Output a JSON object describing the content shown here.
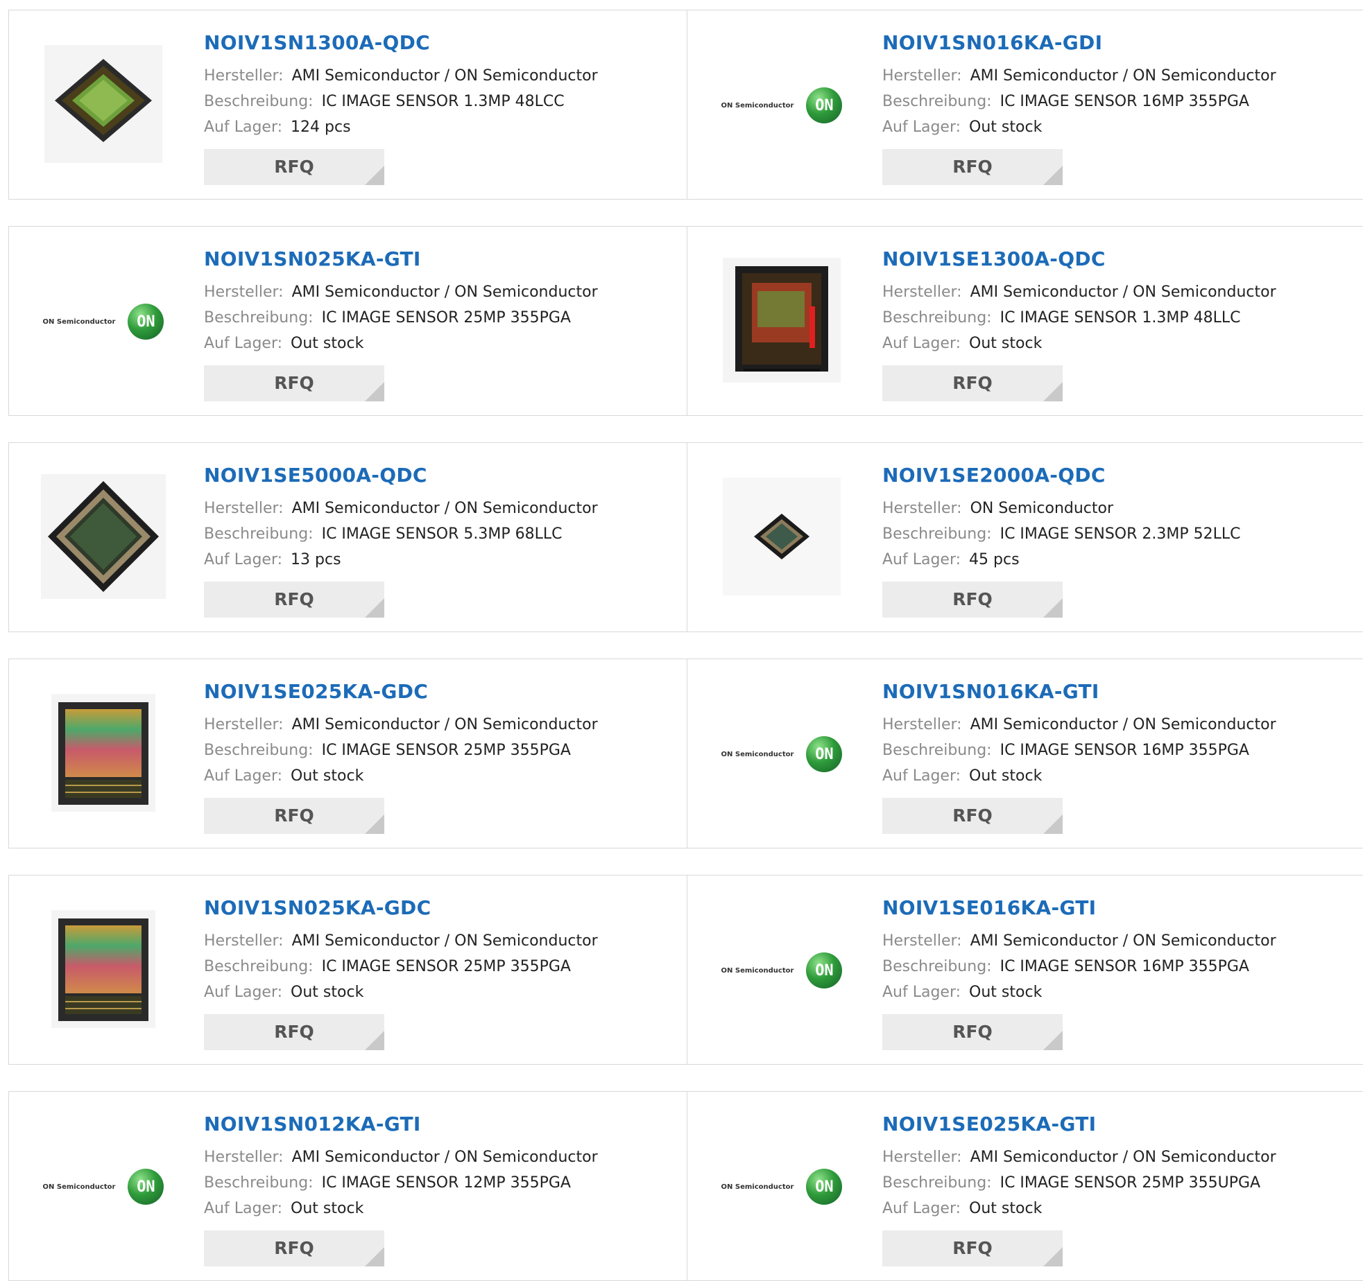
{
  "labels": {
    "manufacturer": "Hersteller:",
    "description": "Beschreibung:",
    "stock": "Auf Lager:",
    "rfq": "RFQ"
  },
  "logo": {
    "text": "ON Semiconductor",
    "mark": "ON"
  },
  "products": [
    {
      "part": "NOIV1SN1300A-QDC",
      "manufacturer": "AMI Semiconductor / ON Semiconductor",
      "description": "IC IMAGE SENSOR 1.3MP 48LCC",
      "stock": "124 pcs",
      "image": "chip-diamond-green-icon"
    },
    {
      "part": "NOIV1SN016KA-GDI",
      "manufacturer": "AMI Semiconductor / ON Semiconductor",
      "description": "IC IMAGE SENSOR 16MP 355PGA",
      "stock": "Out stock",
      "image": "on-semiconductor-logo"
    },
    {
      "part": "NOIV1SN025KA-GTI",
      "manufacturer": "AMI Semiconductor / ON Semiconductor",
      "description": "IC IMAGE SENSOR 25MP 355PGA",
      "stock": "Out stock",
      "image": "on-semiconductor-logo"
    },
    {
      "part": "NOIV1SE1300A-QDC",
      "manufacturer": "AMI Semiconductor / ON Semiconductor",
      "description": "IC IMAGE SENSOR 1.3MP 48LLC",
      "stock": "Out stock",
      "image": "chip-square-red-icon"
    },
    {
      "part": "NOIV1SE5000A-QDC",
      "manufacturer": "AMI Semiconductor / ON Semiconductor",
      "description": "IC IMAGE SENSOR 5.3MP 68LLC",
      "stock": "13 pcs",
      "image": "chip-diamond-large-icon"
    },
    {
      "part": "NOIV1SE2000A-QDC",
      "manufacturer": "ON Semiconductor",
      "description": "IC IMAGE SENSOR 2.3MP 52LLC",
      "stock": "45 pcs",
      "image": "chip-diamond-small-icon"
    },
    {
      "part": "NOIV1SE025KA-GDC",
      "manufacturer": "AMI Semiconductor / ON Semiconductor",
      "description": "IC IMAGE SENSOR 25MP 355PGA",
      "stock": "Out stock",
      "image": "chip-rainbow-icon"
    },
    {
      "part": "NOIV1SN016KA-GTI",
      "manufacturer": "AMI Semiconductor / ON Semiconductor",
      "description": "IC IMAGE SENSOR 16MP 355PGA",
      "stock": "Out stock",
      "image": "on-semiconductor-logo"
    },
    {
      "part": "NOIV1SN025KA-GDC",
      "manufacturer": "AMI Semiconductor / ON Semiconductor",
      "description": "IC IMAGE SENSOR 25MP 355PGA",
      "stock": "Out stock",
      "image": "chip-rainbow-icon"
    },
    {
      "part": "NOIV1SE016KA-GTI",
      "manufacturer": "AMI Semiconductor / ON Semiconductor",
      "description": "IC IMAGE SENSOR 16MP 355PGA",
      "stock": "Out stock",
      "image": "on-semiconductor-logo"
    },
    {
      "part": "NOIV1SN012KA-GTI",
      "manufacturer": "AMI Semiconductor / ON Semiconductor",
      "description": "IC IMAGE SENSOR 12MP 355PGA",
      "stock": "Out stock",
      "image": "on-semiconductor-logo"
    },
    {
      "part": "NOIV1SE025KA-GTI",
      "manufacturer": "AMI Semiconductor / ON Semiconductor",
      "description": "IC IMAGE SENSOR 25MP 355UPGA",
      "stock": "Out stock",
      "image": "on-semiconductor-logo"
    }
  ]
}
